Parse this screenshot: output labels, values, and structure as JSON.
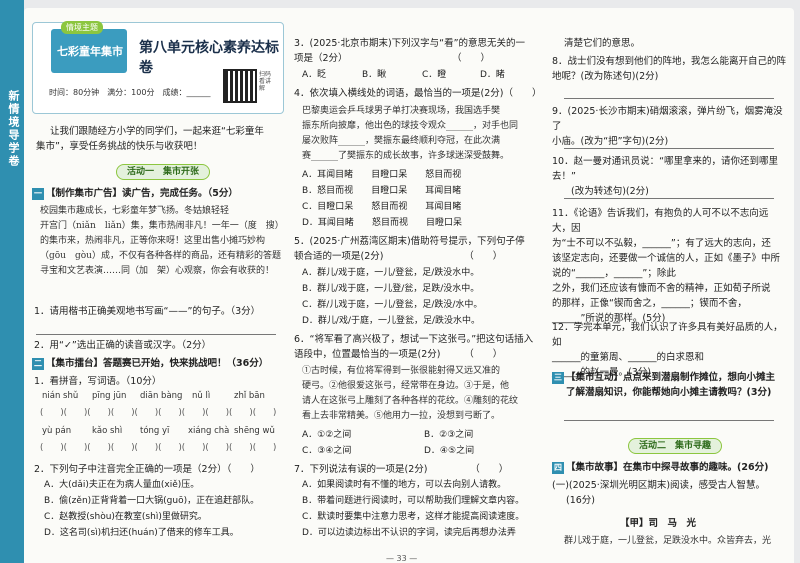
{
  "sidestrip": {
    "vertical_title": "新情境导学卷"
  },
  "header": {
    "tag_theme": "情境主题",
    "tag_name": "七彩童年集市",
    "title": "第八单元核心素养达标卷",
    "info": "时间：80分钟　满分：100分　成绩：______",
    "qr_label": "扫码看讲解"
  },
  "intro": [
    "让我们跟随经方小学的同学们，一起来逛“七彩童年",
    "集市”，享受任务挑战的快乐与收获吧！"
  ],
  "activity1": "活动一　集市开张",
  "sec1": {
    "num": "一",
    "text": "【制作集市广告】读广告，完成任务。（5分）"
  },
  "ad": [
    "校园集市趣成长，七彩童年梦飞扬。冬姑娘轻轻",
    "开宫门（niǎn　liǎn）集，集市热闹非凡！一年一（度　搜）",
    "的集市来，热闹非凡，正等你来呀！这里出售小摊巧妙构",
    "（gōu　gòu）成，不仅有各种各样的商品，还有精彩的答题",
    "寻宝和文艺表演……同（加　架）心观察，你会有收获的！"
  ],
  "q1": [
    "1．请用楷书正确美观地书写画“——”的句子。（3分）"
  ],
  "q2": "2．用“✓”选出正确的读音或汉字。（2分）",
  "sec2": {
    "num": "二",
    "text": "【集市擂台】答题赛已开始，快来挑战吧！（36分）"
  },
  "q3": {
    "stem": "1．看拼音，写词语。（10分）",
    "row1": [
      "nián shǔ",
      "pīng jūn",
      "diān bàng",
      "nǔ lì",
      "zhǐ bān"
    ],
    "row2": [
      "yù pán",
      "kǎo shì",
      "tóng yī",
      "xiáng chà",
      "shēng wǔ"
    ]
  },
  "q4": {
    "stem": "2．下列句子中注音完全正确的一项是（2分）（　　）",
    "opts": [
      "A．大(dǎi)夫正在为病人量血(xiě)压。",
      "B．偷(zěn)正背背着一口大锅(guō)，正在追赶部队。",
      "C．赵教授(shòu)在教室(shì)里做研究。",
      "D．这名司(sì)机扫还(huán)了借来的修车工具。"
    ]
  },
  "col2": [
    {
      "stem": [
        "3．(2025·北京市期末)下列汉字与“看”的意思无关的一",
        "项是（2分）　　　　　　　　　　　　（　　）"
      ],
      "opts": [
        "A．眨",
        "B．瞅",
        "C．瞪",
        "D．睹"
      ]
    },
    {
      "stem": [
        "4．依次填入横线处的词语，最恰当的一项是(2分)（　　）"
      ]
    }
  ],
  "q4passage": [
    "巴黎奥运会乒乓球男子单打决赛现场，我国选手樊",
    "振东所向披靡，他出色的球技令观众______，对手也同",
    "屡次败阵______，樊振东最终顺利夺冠，在此次满",
    "赛______了樊振东的成长故事，许多球迷深受鼓舞。"
  ],
  "q4opts": [
    [
      "A．耳闻目睹",
      "目瞪口呆",
      "怒目而视"
    ],
    [
      "B．怒目而视",
      "目瞪口呆",
      "耳闻目睹"
    ],
    [
      "C．目瞪口呆",
      "怒目而视",
      "耳闻目睹"
    ],
    [
      "D．耳闻目睹",
      "怒目而视",
      "目瞪口呆"
    ]
  ],
  "q5": {
    "stem": [
      "5．(2025·广州荔湾区期末)借助符号提示，下列句子停",
      "顿合适的一项是(2分)　　　　　　　　　（　　）"
    ],
    "opts": [
      "A．群儿/戏于庭，一儿/登瓮，足/跌没水中。",
      "B．群儿/戏于庭，一儿登/瓮，足跌/没水中。",
      "C．群/儿戏于庭，一儿/登瓮，足/跌没/水中。",
      "D．群儿/戏/于庭，一儿登瓮，足/跌没水中。"
    ]
  },
  "q6": {
    "stem": [
      "6．“将军看了高兴极了，想试一下这张弓。”把这句话插入",
      "语段中，位置最恰当的一项是(2分)　　　（　　）"
    ],
    "passage": [
      "①古时候，有位将军得到一张很能射得又远又准的",
      "硬弓。②他很爱这张弓，经常带在身边。③于是，他",
      "请人在这张弓上雕刻了各种各样的花纹。④雕刻的花纹",
      "看上去非常精美。⑤他用力一拉，没想到弓断了。"
    ],
    "opts": [
      "A．①②之间",
      "B．②③之间",
      "C．③④之间",
      "D．④⑤之间"
    ]
  },
  "q7": {
    "stem": "7．下列说法有误的一项是(2分)　　　　　（　　）",
    "opts": [
      "A．如果阅读时有不懂的地方，可以去向别人请教。",
      "B．带着问题进行阅读时，可以帮助我们理解文章内容。",
      "C．默读时要集中注意力思考，这样才能提高阅读速度。",
      "D．可以边读边标出不认识的字词，读完后再想办法弄"
    ]
  },
  "col3": {
    "carry": "清楚它们的意思。",
    "q8": [
      "8．战士们没有想到他们的阵地，我怎么能离开自己的阵",
      "地呢？(改为陈述句)(2分)"
    ],
    "q9": [
      "9．(2025·长沙市期末)硝烟滚滚，弹片纷飞，烟雾淹没了",
      "小庙。(改为“把”字句)(2分)"
    ],
    "q10": [
      "10．赵一曼对通讯员说：“哪里拿来的，请你还到哪里去！”",
      "　　(改为转述句)(2分)"
    ],
    "q11": [
      "11．《论语》告诉我们，有抱负的人可不以不志向远大，因",
      "为“士不可以不弘毅，______”；有了远大的志向，还",
      "该坚定志向，还要做一个诚信的人，正如《墨子》中所",
      "说的“______，______”；除此",
      "之外，我们还应该有慷而不舍的精神，正如荀子所说",
      "的那样，正像“锲而舍之，______；锲而不舍，",
      "______”所说的那样。(5分)"
    ],
    "q12": [
      "12．学完本单元，我们认识了许多具有美好品质的人，如",
      "______的童第周、______的白求恩和",
      "______的赵一曼。(3分)"
    ],
    "sec3": {
      "num": "三",
      "text": "【集市互动】点点来到潜扇制作摊位，想向小摊主",
      "text2": "了解潜扇知识，你能帮她向小摊主请教吗？(3分)"
    },
    "activity2": "活动二　集市寻趣",
    "sec4": {
      "num": "四",
      "text": "【集市故事】在集市中探寻故事的趣味。(26分)"
    },
    "q13": [
      "(一)(2025·深圳光明区期末)阅读，感受古人智慧。",
      "(16分)"
    ],
    "reading_title": "【甲】司　马　光",
    "reading_line": "群儿戏于庭，一儿登瓮，足跌没水中。众皆弃去，光"
  },
  "pagenum": "— 33 —"
}
